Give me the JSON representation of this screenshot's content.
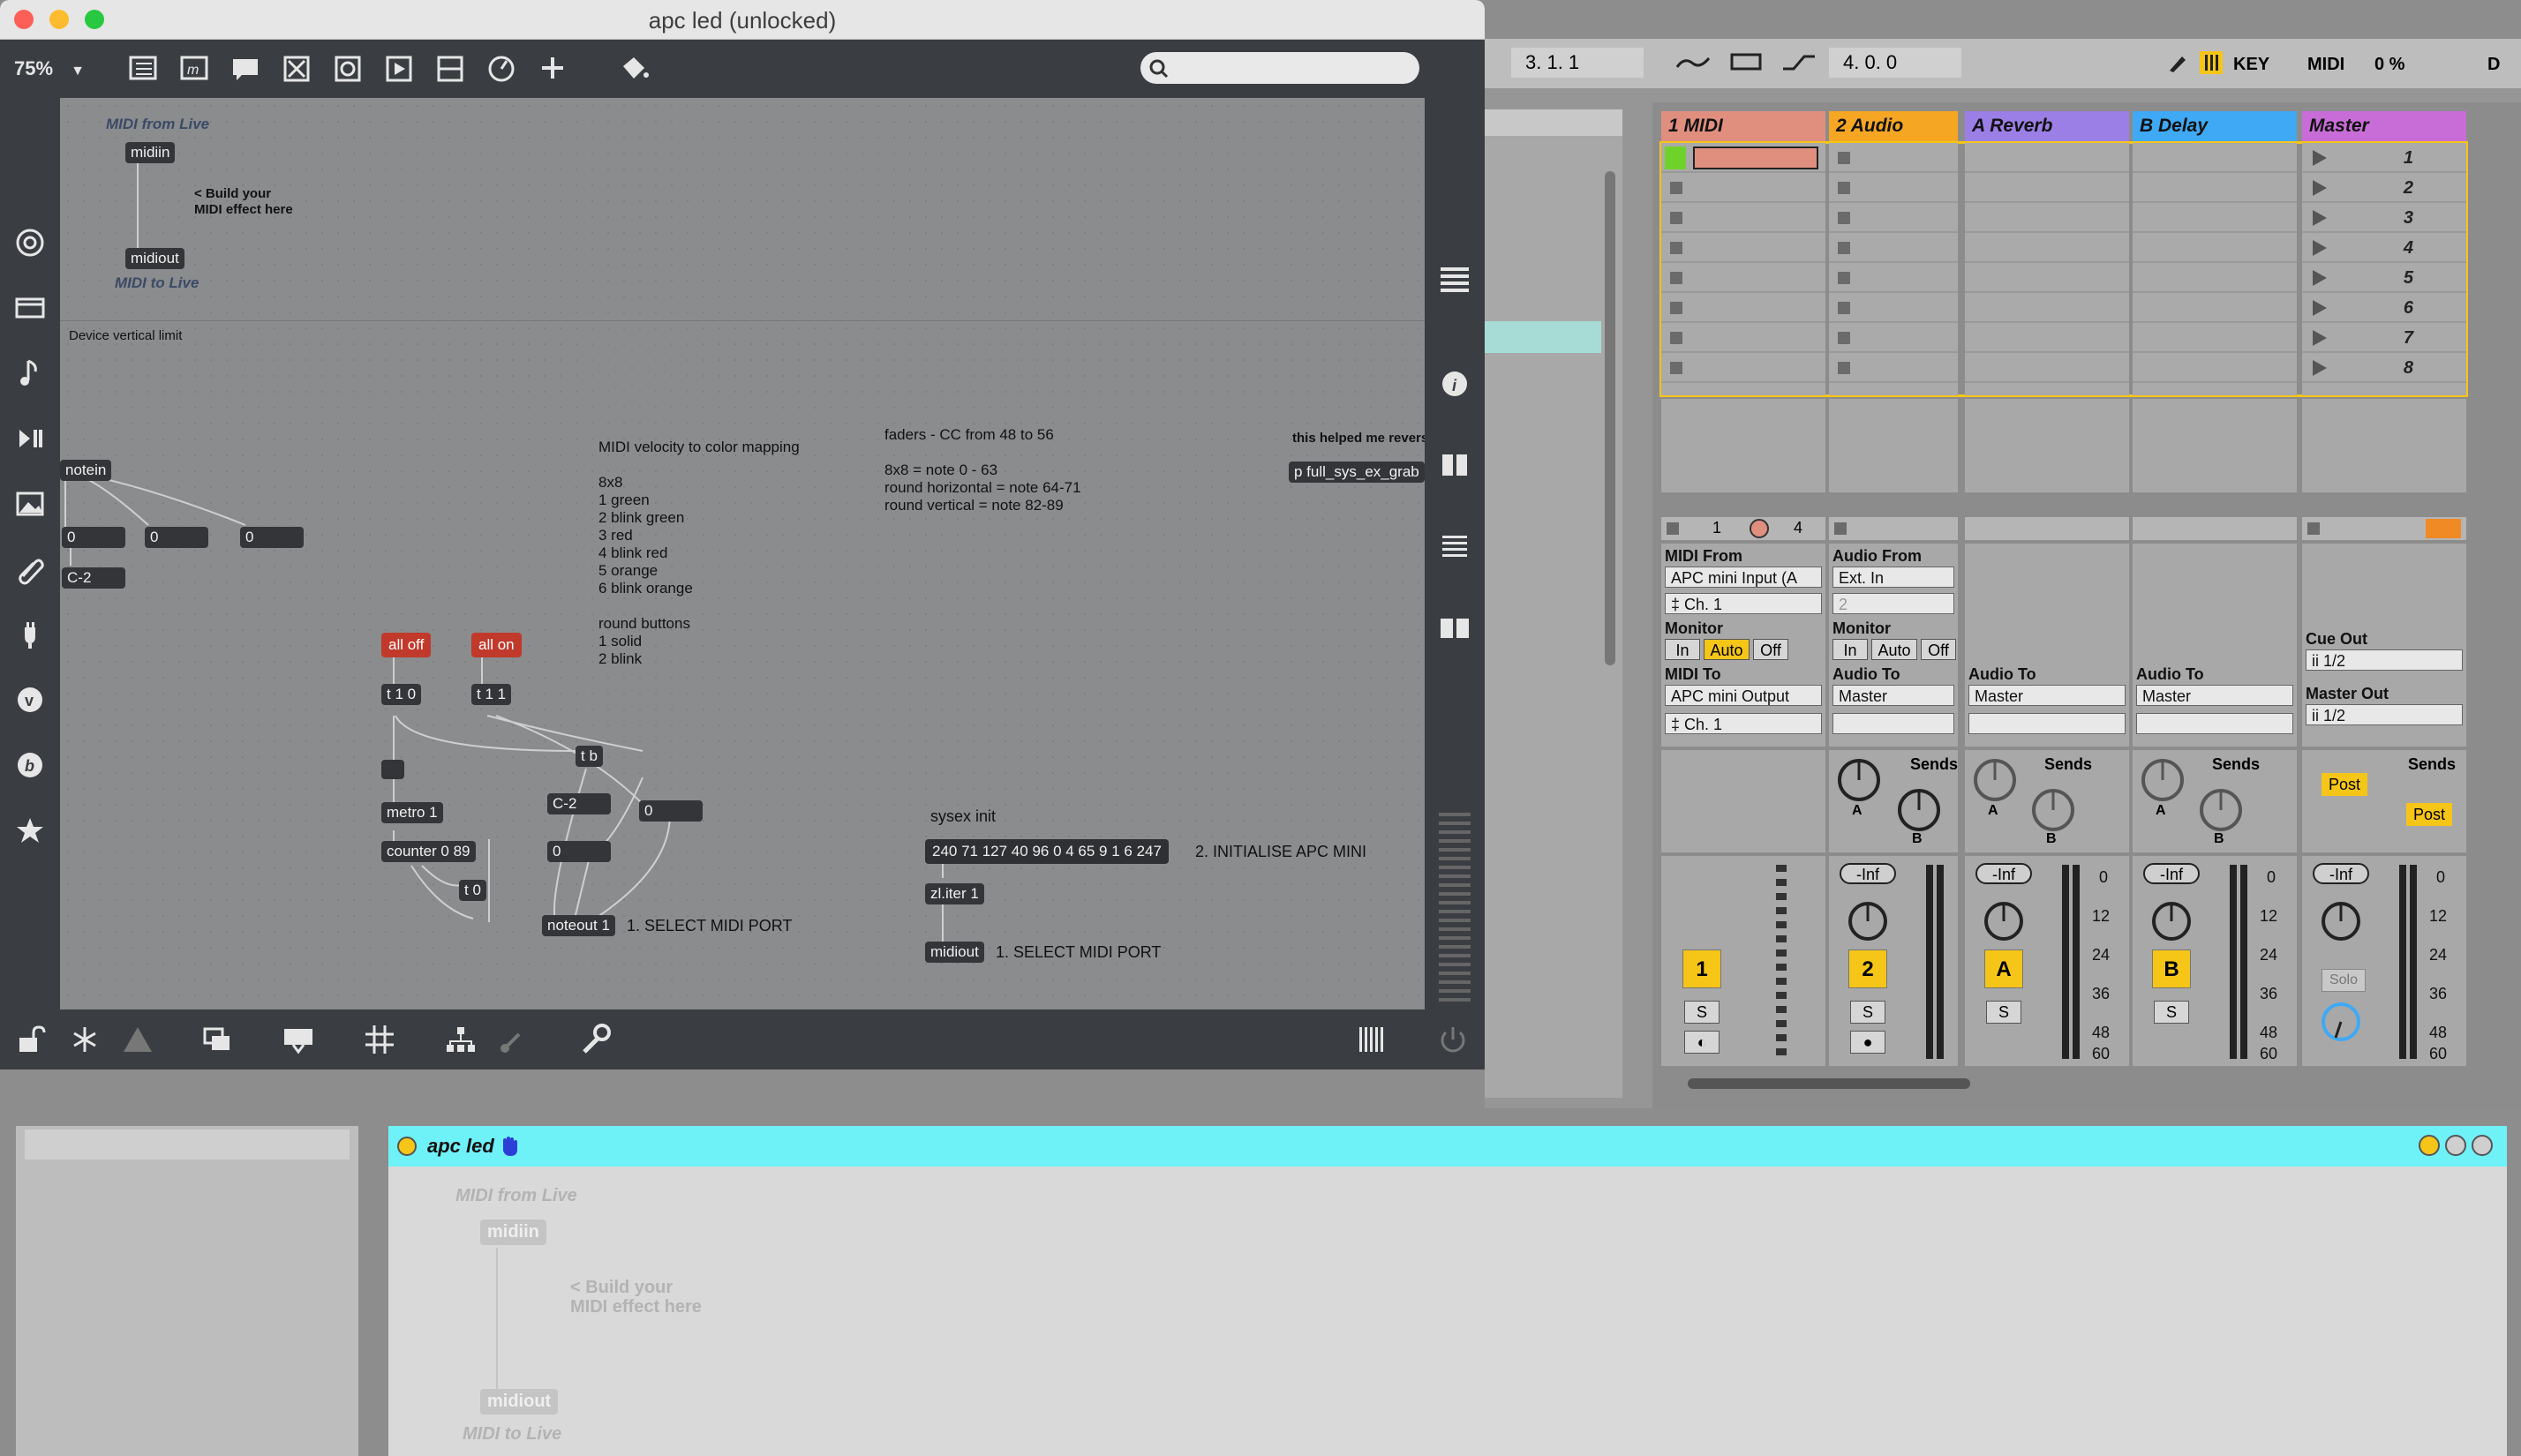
{
  "max_window": {
    "title": "apc led (unlocked)",
    "zoom": "75%",
    "search": {
      "placeholder": ""
    }
  },
  "patch": {
    "midi_from_live": "MIDI from Live",
    "midiin": "midiin",
    "build_comment_1": "< Build your",
    "build_comment_2": "MIDI effect here",
    "midiout": "midiout",
    "midi_to_live": "MIDI to Live",
    "device_vertical_limit": "Device vertical limit",
    "notein": "notein",
    "notein_outputs": [
      "0",
      "0",
      "0"
    ],
    "note_name": "C-2",
    "velocity_comment": [
      "MIDI velocity to color mapping",
      "",
      "8x8",
      "1 green",
      "2 blink green",
      "3 red",
      "4 blink red",
      "5 orange",
      "6 blink orange",
      "",
      "round buttons",
      "1 solid",
      "2 blink"
    ],
    "faders_comment": [
      "faders - CC from 48 to 56",
      "",
      "8x8 = note 0 - 63",
      "round horizontal = note 64-71",
      "round vertical = note 82-89"
    ],
    "helped_comment": "this helped me revers",
    "p_object": "p full_sys_ex_grab",
    "all_off": "all off",
    "all_on": "all on",
    "t10": "t 1 0",
    "t11": "t 1 1",
    "tb": "t b",
    "metro": "metro 1",
    "counter": "counter 0 89",
    "t0": "t 0",
    "c2b": "C-2",
    "zero_a": "0",
    "zero_b": "0",
    "noteout": "noteout 1",
    "select_port_1": "1. SELECT MIDI PORT",
    "sysex_init": "sysex init",
    "sysex_msg": "240 71 127 40 96 0 4 65 9 1 6 247",
    "initialise": "2. INITIALISE APC MINI",
    "zl_iter": "zl.iter 1",
    "midiout2": "midiout",
    "select_port_2": "1. SELECT MIDI PORT"
  },
  "live": {
    "transport": {
      "position": "3.   1.   1",
      "end": "4.   0.   0",
      "key": "KEY",
      "midi": "MIDI",
      "cpu": "0 %",
      "d": "D"
    },
    "tracks": [
      {
        "name": "1 MIDI",
        "color": "#e08f7f"
      },
      {
        "name": "2 Audio",
        "color": "#f5a623"
      },
      {
        "name": "A Reverb",
        "color": "#9b7fe6"
      },
      {
        "name": "B Delay",
        "color": "#3fa9f5"
      },
      {
        "name": "Master",
        "color": "#c86dd7"
      }
    ],
    "scenes": [
      "1",
      "2",
      "3",
      "4",
      "5",
      "6",
      "7",
      "8"
    ],
    "io": {
      "t1_midi_from_label": "MIDI From",
      "t1_midi_from": "APC mini Input (A",
      "t1_ch": "‡ Ch. 1",
      "t1_monitor_label": "Monitor",
      "t1_mon": [
        "In",
        "Auto",
        "Off"
      ],
      "t1_midi_to_label": "MIDI To",
      "t1_midi_to": "APC mini Output",
      "t1_ch2": "‡ Ch. 1",
      "t2_audio_from_label": "Audio From",
      "t2_audio_from": "Ext. In",
      "t2_input_ch": "2",
      "t2_monitor_label": "Monitor",
      "t2_mon": [
        "In",
        "Auto",
        "Off"
      ],
      "t2_audio_to_label": "Audio To",
      "t2_audio_to": "Master",
      "a_audio_to_label": "Audio To",
      "a_audio_to": "Master",
      "b_audio_to_label": "Audio To",
      "b_audio_to": "Master",
      "cue_out_label": "Cue Out",
      "cue_out": "ii 1/2",
      "master_out_label": "Master Out",
      "master_out": "ii 1/2",
      "t1_row": [
        "1",
        "4"
      ]
    },
    "sends": "Sends",
    "post": "Post",
    "knob_a": "A",
    "knob_b": "B",
    "inf": "-Inf",
    "db": [
      "0",
      "12",
      "24",
      "36",
      "48",
      "60"
    ],
    "track_numbers": [
      "1",
      "2",
      "A",
      "B"
    ],
    "solo": "S",
    "solo_master": "Solo"
  },
  "device": {
    "name": "apc led",
    "midi_from_live": "MIDI from Live",
    "midiin": "midiin",
    "build_1": "< Build your",
    "build_2": "MIDI effect here",
    "midiout": "midiout",
    "midi_to_live": "MIDI to Live"
  }
}
